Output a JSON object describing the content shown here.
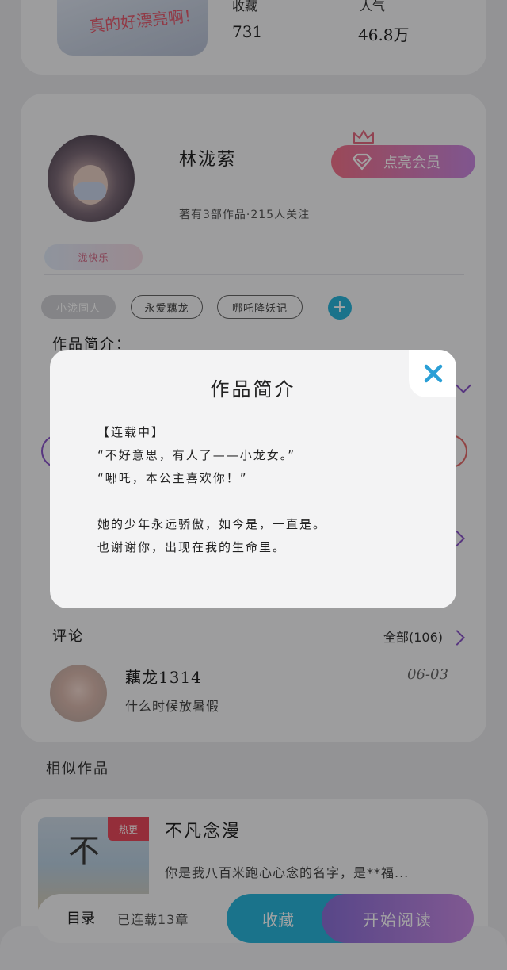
{
  "top_card": {
    "cover_text": "真的好漂亮啊！",
    "favorites_label": "收藏",
    "favorites_value": "731",
    "popularity_label": "人气",
    "popularity_value": "46.8万"
  },
  "author": {
    "name": "林泷萦",
    "meta": "著有3部作品·215人关注",
    "badge": "泷快乐",
    "vip_button": "点亮会员"
  },
  "tags": [
    "小泷同人",
    "永爱藕龙",
    "哪吒降妖记"
  ],
  "intro": {
    "section_title": "作品简介："
  },
  "comments": {
    "title": "评论",
    "see_all": "全部(106)",
    "items": [
      {
        "user": "藕龙1314",
        "date": "06-03",
        "text": "什么时候放暑假"
      }
    ]
  },
  "similar": {
    "title": "相似作品",
    "items": [
      {
        "cover_glyph": "不",
        "tag": "热更",
        "title": "不凡念漫",
        "desc": "你是我八百米跑心心念的名字，是**福..."
      }
    ]
  },
  "bottom_bar": {
    "toc": "目录",
    "serial_status": "已连载13章",
    "collect": "收藏",
    "read": "开始阅读"
  },
  "modal": {
    "title": "作品简介",
    "lines": [
      "【连载中】",
      "“不好意思，有人了——小龙女。”",
      "“哪吒，本公主喜欢你！”",
      "",
      "她的少年永远骄傲，如今是，一直是。",
      "也谢谢你，出现在我的生命里。"
    ]
  },
  "colors": {
    "accent_blue": "#2ab4d9",
    "accent_purple": "#8a6fd6",
    "vip_gradient_start": "#f2728a",
    "vip_gradient_end": "#c887e0",
    "tag_red": "#e8495c"
  },
  "icons": {
    "crown": "crown-icon",
    "diamond": "diamond-icon",
    "close": "close-icon",
    "add": "plus-icon",
    "chevron": "chevron-right-icon"
  }
}
